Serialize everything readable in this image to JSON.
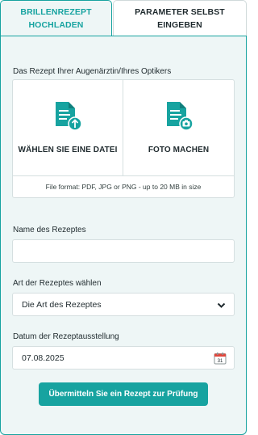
{
  "tabs": [
    {
      "label_line1": "BRILLENREZEPT",
      "label_line2": "HOCHLADEN",
      "active": true
    },
    {
      "label_line1": "PARAMETER SELBST",
      "label_line2": "EINGEBEN",
      "active": false
    }
  ],
  "upload": {
    "section_label": "Das Rezept Ihrer Augenärztin/Ihres Optikers",
    "choose_file_label": "WÄHLEN SIE EINE DATEI",
    "take_photo_label": "FOTO MACHEN",
    "file_format_note": "File format: PDF, JPG or PNG - up to 20 MB in size",
    "file_icon": "document-upload-icon",
    "photo_icon": "document-camera-icon"
  },
  "recipe_name": {
    "label": "Name des Rezeptes",
    "value": ""
  },
  "recipe_type": {
    "label": "Art der Rezeptes wählen",
    "selected": "Die Art des Rezeptes",
    "icon": "chevron-down-icon"
  },
  "issue_date": {
    "label": "Datum der Rezeptausstellung",
    "value": "07.08.2025",
    "icon": "calendar-icon",
    "calendar_day": "31"
  },
  "submit": {
    "label": "Übermitteln Sie ein Rezept zur Prüfung"
  },
  "colors": {
    "accent": "#17a3a0",
    "panel_bg": "#eef6f6",
    "border": "#d5dfe0",
    "calendar_red": "#e0463c"
  }
}
